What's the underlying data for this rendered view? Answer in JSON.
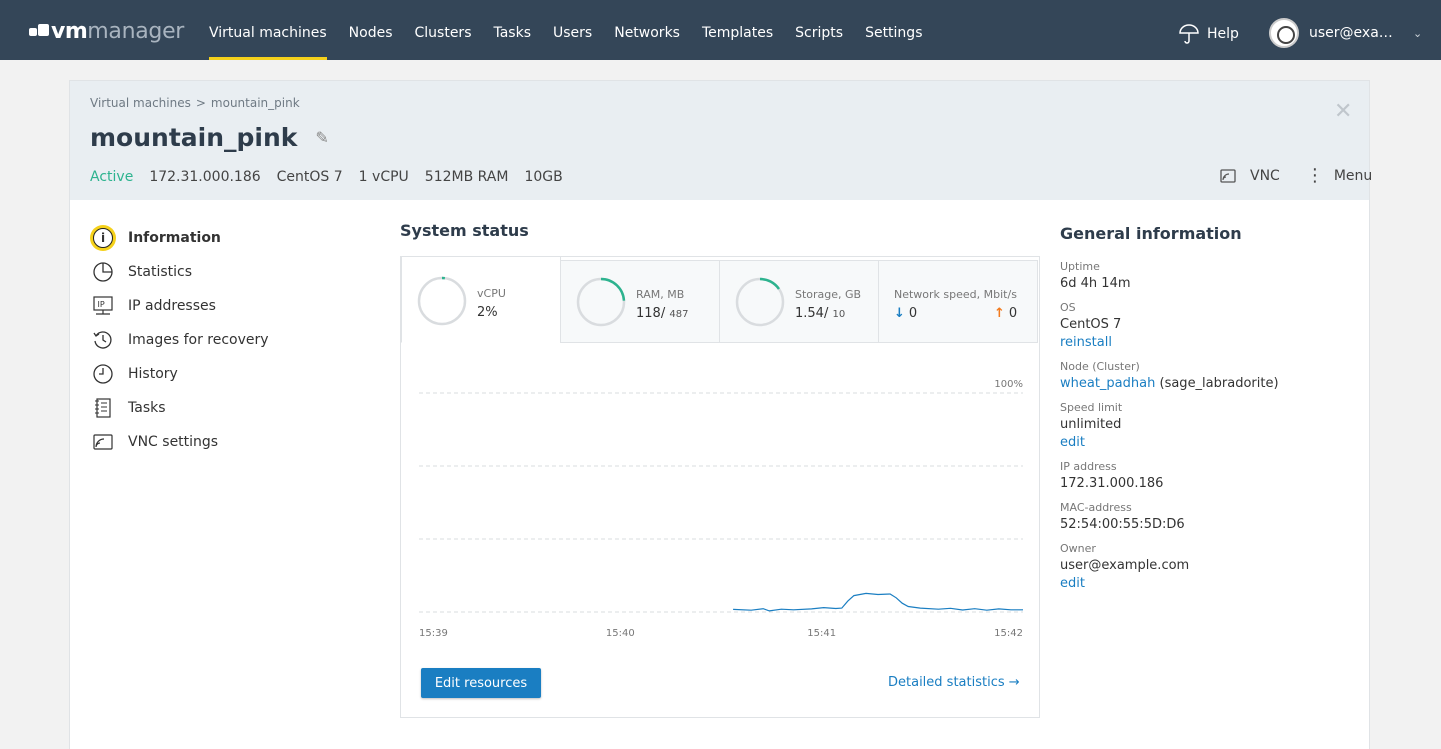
{
  "brand": {
    "prefix": "vm",
    "suffix": "manager"
  },
  "nav": {
    "items": [
      {
        "label": "Virtual machines",
        "active": true
      },
      {
        "label": "Nodes"
      },
      {
        "label": "Clusters"
      },
      {
        "label": "Tasks"
      },
      {
        "label": "Users"
      },
      {
        "label": "Networks"
      },
      {
        "label": "Templates"
      },
      {
        "label": "Scripts"
      },
      {
        "label": "Settings"
      }
    ],
    "help": "Help",
    "user": "user@example.com"
  },
  "breadcrumb": {
    "parent": "Virtual machines",
    "separator": ">",
    "current": "mountain_pink"
  },
  "vm": {
    "name": "mountain_pink",
    "status": "Active",
    "ip": "172.31.000.186",
    "os": "CentOS 7",
    "cpu": "1 vCPU",
    "ram": "512MB RAM",
    "disk": "10GB"
  },
  "actions": {
    "vnc": "VNC",
    "menu": "Menu"
  },
  "side_menu": [
    {
      "label": "Information",
      "icon": "info-icon",
      "active": true
    },
    {
      "label": "Statistics",
      "icon": "pie-chart-icon"
    },
    {
      "label": "IP addresses",
      "icon": "ip-icon"
    },
    {
      "label": "Images for recovery",
      "icon": "restore-icon"
    },
    {
      "label": "History",
      "icon": "clock-icon"
    },
    {
      "label": "Tasks",
      "icon": "tasks-icon"
    },
    {
      "label": "VNC settings",
      "icon": "vnc-icon"
    }
  ],
  "system_status": {
    "title": "System status",
    "cards": {
      "vcpu": {
        "label": "vCPU",
        "value": "2%",
        "fraction": 0.02
      },
      "ram": {
        "label": "RAM, MB",
        "value": "118/",
        "total": "487",
        "fraction": 0.24
      },
      "storage": {
        "label": "Storage, GB",
        "value": "1.54/",
        "total": "10",
        "fraction": 0.154
      },
      "network": {
        "label": "Network speed, Mbit/s",
        "down": "0",
        "up": "0"
      }
    },
    "edit_button": "Edit resources",
    "detail_link": "Detailed statistics →"
  },
  "chart_data": {
    "type": "line",
    "y_max_label": "100%",
    "ylim": [
      0,
      100
    ],
    "x_ticks": [
      "15:39",
      "15:40",
      "15:41",
      "15:42"
    ],
    "grid": true,
    "series": [
      {
        "color": "#1a7ec2",
        "points": [
          [
            0.52,
            1.2
          ],
          [
            0.55,
            0.8
          ],
          [
            0.57,
            1.5
          ],
          [
            0.58,
            0.5
          ],
          [
            0.6,
            1.3
          ],
          [
            0.62,
            1.0
          ],
          [
            0.65,
            1.4
          ],
          [
            0.67,
            2.0
          ],
          [
            0.69,
            1.6
          ],
          [
            0.7,
            1.8
          ],
          [
            0.71,
            5.0
          ],
          [
            0.72,
            7.5
          ],
          [
            0.74,
            8.5
          ],
          [
            0.76,
            8.0
          ],
          [
            0.78,
            8.2
          ],
          [
            0.79,
            6.5
          ],
          [
            0.8,
            4.0
          ],
          [
            0.81,
            2.5
          ],
          [
            0.83,
            1.8
          ],
          [
            0.86,
            1.3
          ],
          [
            0.88,
            1.7
          ],
          [
            0.9,
            0.9
          ],
          [
            0.92,
            1.5
          ],
          [
            0.94,
            0.8
          ],
          [
            0.96,
            1.4
          ],
          [
            0.98,
            1.0
          ],
          [
            1.0,
            1.0
          ]
        ]
      }
    ]
  },
  "general": {
    "title": "General information",
    "uptime_label": "Uptime",
    "uptime": "6d 4h 14m",
    "os_label": "OS",
    "os": "CentOS 7",
    "os_action": "reinstall",
    "node_label": "Node (Cluster)",
    "node": "wheat_padhah",
    "cluster": "(sage_labradorite)",
    "speed_label": "Speed limit",
    "speed": "unlimited",
    "speed_action": "edit",
    "ip_label": "IP address",
    "ip": "172.31.000.186",
    "mac_label": "MAC-address",
    "mac": "52:54:00:55:5D:D6",
    "owner_label": "Owner",
    "owner": "user@example.com",
    "owner_action": "edit"
  }
}
